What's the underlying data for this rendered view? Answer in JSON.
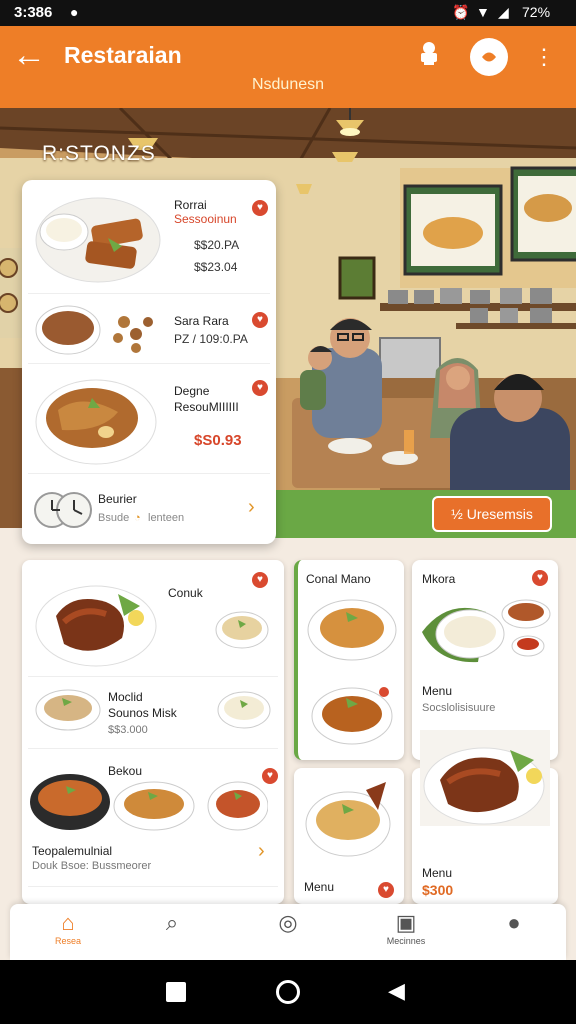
{
  "status_bar": {
    "time": "3:386",
    "battery": "72%"
  },
  "app_bar": {
    "title": "Restaraian",
    "subtitle": "Nsdunesn",
    "back_icon": "arrow-left-icon",
    "chef_icon": "chef-icon",
    "profile_icon": "profile-circle-icon",
    "more_icon": "more-vertical-icon"
  },
  "hero": {
    "heading": "R:STONZS",
    "order_button": "½ Uresemsis"
  },
  "featured_list": [
    {
      "name": "Rorrai",
      "subname": "Sessooinun",
      "price1": "$$20.PA",
      "price2": "$$23.04"
    },
    {
      "name": "Sara Rara",
      "subname": "PZ / 109:0.PA"
    },
    {
      "name": "Degne",
      "subname": "ResouMIIIIII",
      "price": "$S0.93"
    },
    {
      "name": "Beurier",
      "subname": "Bsude",
      "extra": "lenteen"
    }
  ],
  "menu": {
    "card_a": {
      "title": "Conuk",
      "item1": "Moclid",
      "item2": "Sounos Misk",
      "price": "$$3.000",
      "section": "Bekou",
      "footer": "Teopalemulnial",
      "footer_sub": "Douk Bsoe: Bussmeorer"
    },
    "card_b": {
      "title": "Conal Mano"
    },
    "card_c": {
      "title": "Menu"
    },
    "card_d": {
      "title": "Mkora",
      "label": "Menu",
      "sub": "Socslolisisuure"
    },
    "card_e": {
      "label": "Menu",
      "price": "$300"
    }
  },
  "bottom_nav": [
    {
      "label": "Resea",
      "icon": "home-icon"
    },
    {
      "label": "",
      "icon": "search-icon"
    },
    {
      "label": "",
      "icon": "compass-icon"
    },
    {
      "label": "Mecinnes",
      "icon": "menu-book-icon"
    },
    {
      "label": "",
      "icon": "user-icon"
    }
  ],
  "colors": {
    "primary": "#ee7e27",
    "accent_green": "#6aa845",
    "fav_red": "#d94a30"
  }
}
